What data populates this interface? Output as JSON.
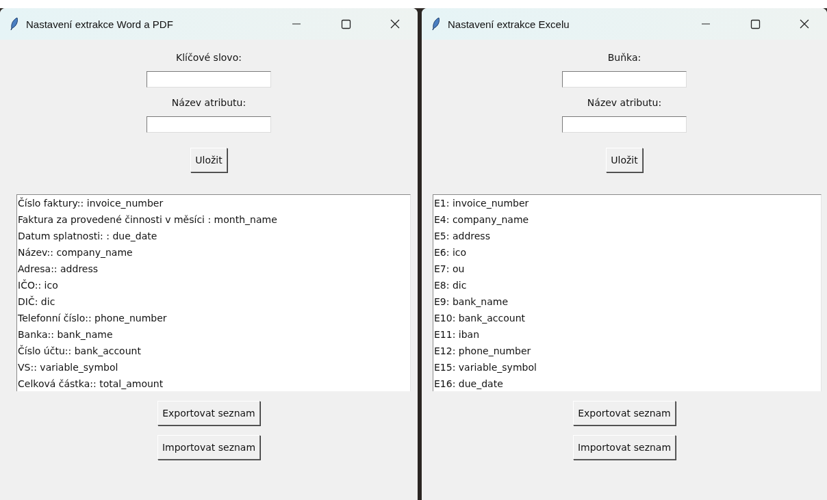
{
  "windows": [
    {
      "title": "Nastavení extrakce Word a PDF",
      "fields": [
        {
          "label": "Klíčové slovo:"
        },
        {
          "label": "Název atributu:"
        }
      ],
      "save_button": "Uložit",
      "list_items": [
        "Číslo faktury:: invoice_number",
        "Faktura za provedené činnosti v měsíci : month_name",
        "Datum splatnosti: : due_date",
        "Název:: company_name",
        "Adresa:: address",
        "IČO:: ico",
        "DIČ: dic",
        "Telefonní číslo:: phone_number",
        "Banka:: bank_name",
        "Číslo účtu:: bank_account",
        "VS:: variable_symbol",
        "Celková částka:: total_amount"
      ],
      "buttons": [
        "Exportovat seznam",
        "Importovat seznam"
      ]
    },
    {
      "title": "Nastavení extrakce Excelu",
      "fields": [
        {
          "label": "Buňka:"
        },
        {
          "label": "Název atributu:"
        }
      ],
      "save_button": "Uložit",
      "list_items": [
        "E1: invoice_number",
        "E4: company_name",
        "E5: address",
        "E6: ico",
        "E7: ou",
        "E8: dic",
        "E9: bank_name",
        "E10: bank_account",
        "E11: iban",
        "E12: phone_number",
        "E15: variable_symbol",
        "E16: due_date"
      ],
      "buttons": [
        "Exportovat seznam",
        "Importovat seznam"
      ]
    }
  ]
}
